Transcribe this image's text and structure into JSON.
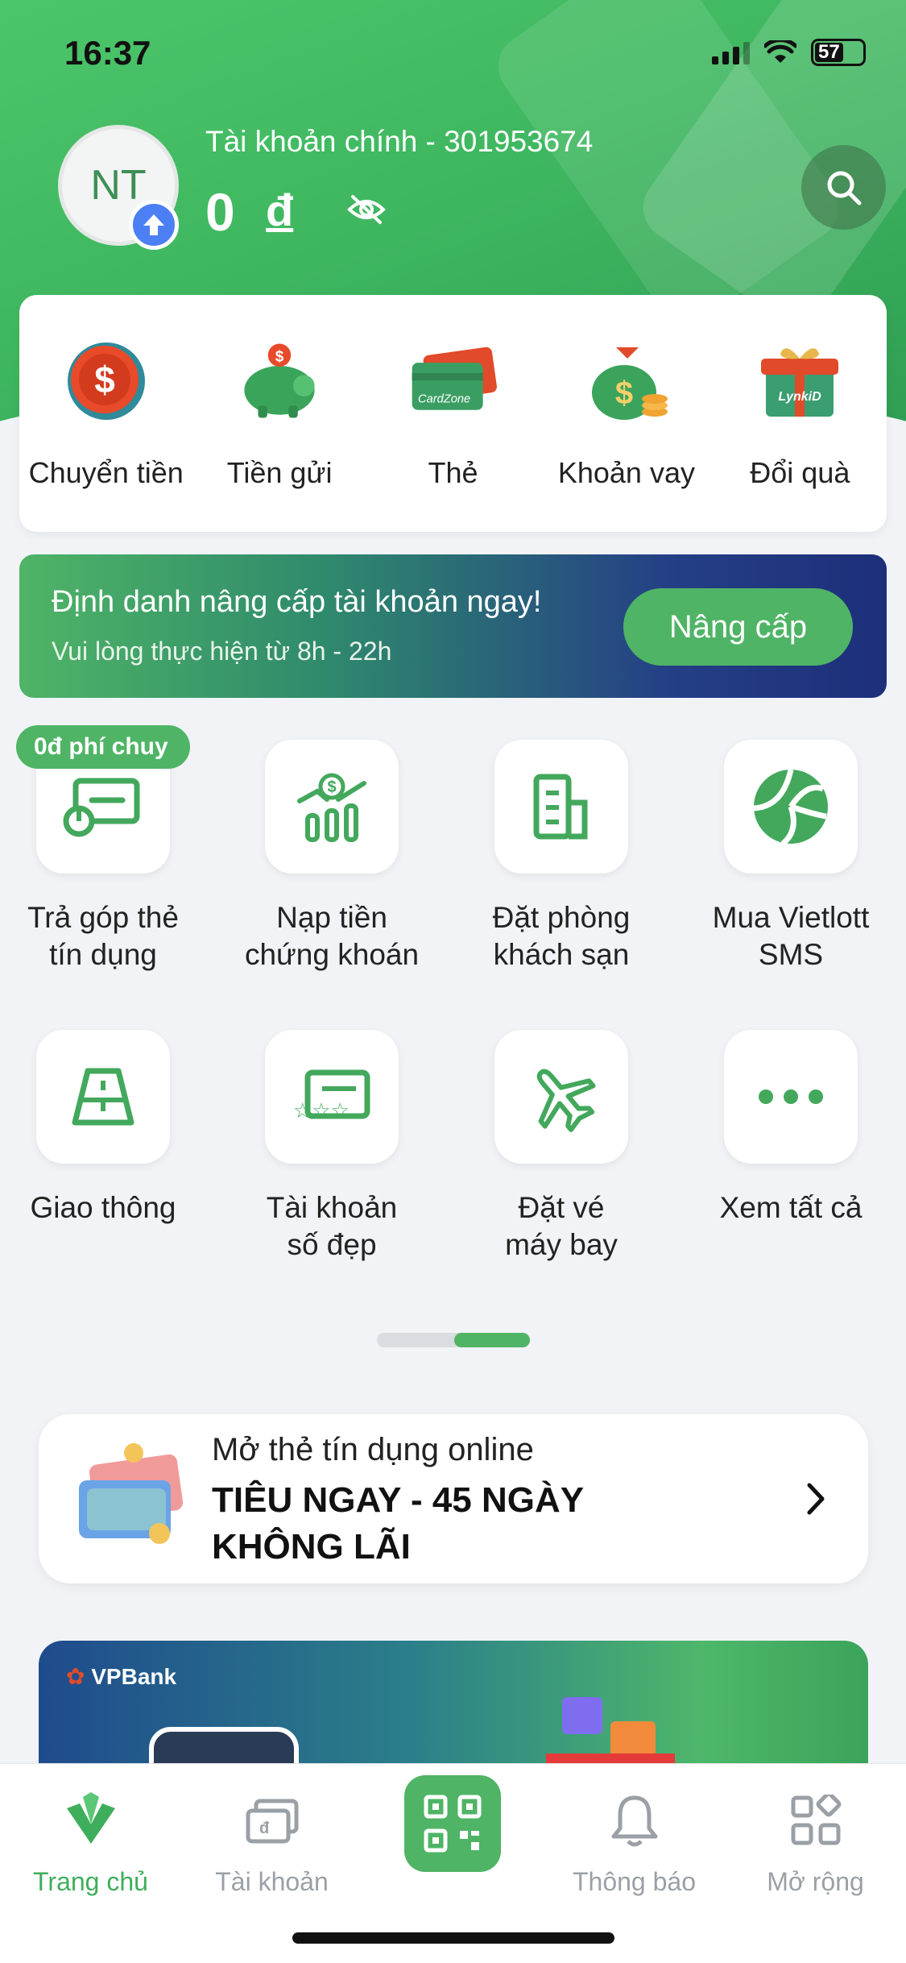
{
  "status_bar": {
    "time": "16:37",
    "battery": "57"
  },
  "header": {
    "avatar_initials": "NT",
    "account_title": "Tài khoản chính - 301953674",
    "balance": "0",
    "currency": "đ"
  },
  "quick_actions": [
    {
      "label": "Chuyển tiền",
      "icon": "transfer-icon"
    },
    {
      "label": "Tiền gửi",
      "icon": "piggy-bank-icon"
    },
    {
      "label": "Thẻ",
      "icon": "card-icon"
    },
    {
      "label": "Khoản vay",
      "icon": "loan-icon"
    },
    {
      "label": "Đổi quà",
      "icon": "gift-icon"
    }
  ],
  "upgrade_banner": {
    "title": "Định danh nâng cấp tài khoản ngay!",
    "subtitle": "Vui lòng thực hiện từ 8h - 22h",
    "button": "Nâng cấp"
  },
  "services": {
    "promo_badge": "0đ phí chuy",
    "items": [
      {
        "label_1": "Trả góp thẻ",
        "label_2": "tín dụng",
        "icon": "card-installment-icon"
      },
      {
        "label_1": "Nạp tiền",
        "label_2": "chứng khoán",
        "icon": "stock-topup-icon"
      },
      {
        "label_1": "Đặt phòng",
        "label_2": "khách sạn",
        "icon": "hotel-icon"
      },
      {
        "label_1": "Mua Vietlott",
        "label_2": "SMS",
        "icon": "vietlott-icon"
      },
      {
        "label_1": "Giao thông",
        "label_2": "",
        "icon": "road-icon"
      },
      {
        "label_1": "Tài khoản",
        "label_2": "số đẹp",
        "icon": "nice-number-icon"
      },
      {
        "label_1": "Đặt vé",
        "label_2": "máy bay",
        "icon": "airplane-icon"
      },
      {
        "label_1": "Xem tất cả",
        "label_2": "",
        "icon": "more-icon"
      }
    ]
  },
  "credit_promo": {
    "subtitle": "Mở thẻ tín dụng online",
    "title": "TIÊU NGAY - 45 NGÀY KHÔNG LÃI"
  },
  "promo_banner": {
    "logo": "VPBank"
  },
  "tabbar": [
    {
      "label": "Trang chủ",
      "icon": "home-leaf-icon",
      "active": true
    },
    {
      "label": "Tài khoản",
      "icon": "account-icon",
      "active": false
    },
    {
      "label": "",
      "icon": "qr-code-icon",
      "active": false
    },
    {
      "label": "Thông báo",
      "icon": "bell-icon",
      "active": false
    },
    {
      "label": "Mở rộng",
      "icon": "grid-icon",
      "active": false
    }
  ],
  "colors": {
    "brand_green": "#4fb465",
    "banner_blue": "#1d2f7a",
    "badge_blue": "#4c7ff3"
  }
}
